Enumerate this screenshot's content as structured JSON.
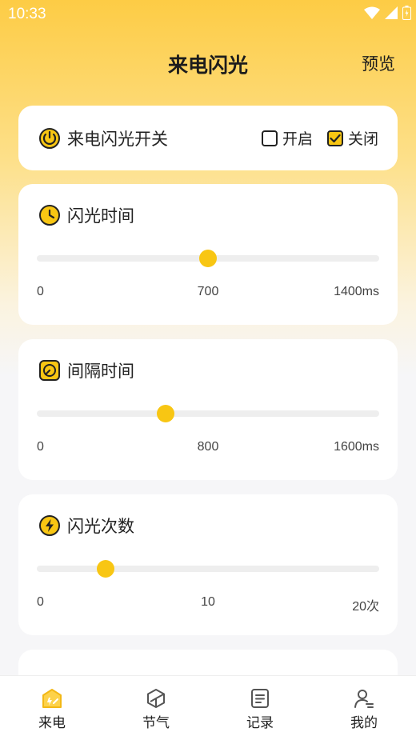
{
  "status_bar": {
    "time": "10:33"
  },
  "header": {
    "title": "来电闪光",
    "preview_label": "预览"
  },
  "flash_switch": {
    "title": "来电闪光开关",
    "options": [
      {
        "label": "开启",
        "checked": false
      },
      {
        "label": "关闭",
        "checked": true
      }
    ]
  },
  "sliders": [
    {
      "title": "闪光时间",
      "icon": "clock-icon",
      "min_label": "0",
      "mid_label": "700",
      "max_label": "1400ms",
      "value": 700,
      "min": 0,
      "max": 1400
    },
    {
      "title": "间隔时间",
      "icon": "timer-icon",
      "min_label": "0",
      "mid_label": "800",
      "max_label": "1600ms",
      "value": 600,
      "min": 0,
      "max": 1600
    },
    {
      "title": "闪光次数",
      "icon": "lightning-icon",
      "min_label": "0",
      "mid_label": "10",
      "max_label": "20次",
      "value": 4,
      "min": 0,
      "max": 20
    }
  ],
  "tabs": [
    {
      "label": "来电",
      "icon": "call-flash-icon",
      "active": true
    },
    {
      "label": "节气",
      "icon": "cube-icon",
      "active": false
    },
    {
      "label": "记录",
      "icon": "document-icon",
      "active": false
    },
    {
      "label": "我的",
      "icon": "person-icon",
      "active": false
    }
  ],
  "colors": {
    "accent": "#f8c613",
    "header_gradient_top": "#fdcc45"
  }
}
